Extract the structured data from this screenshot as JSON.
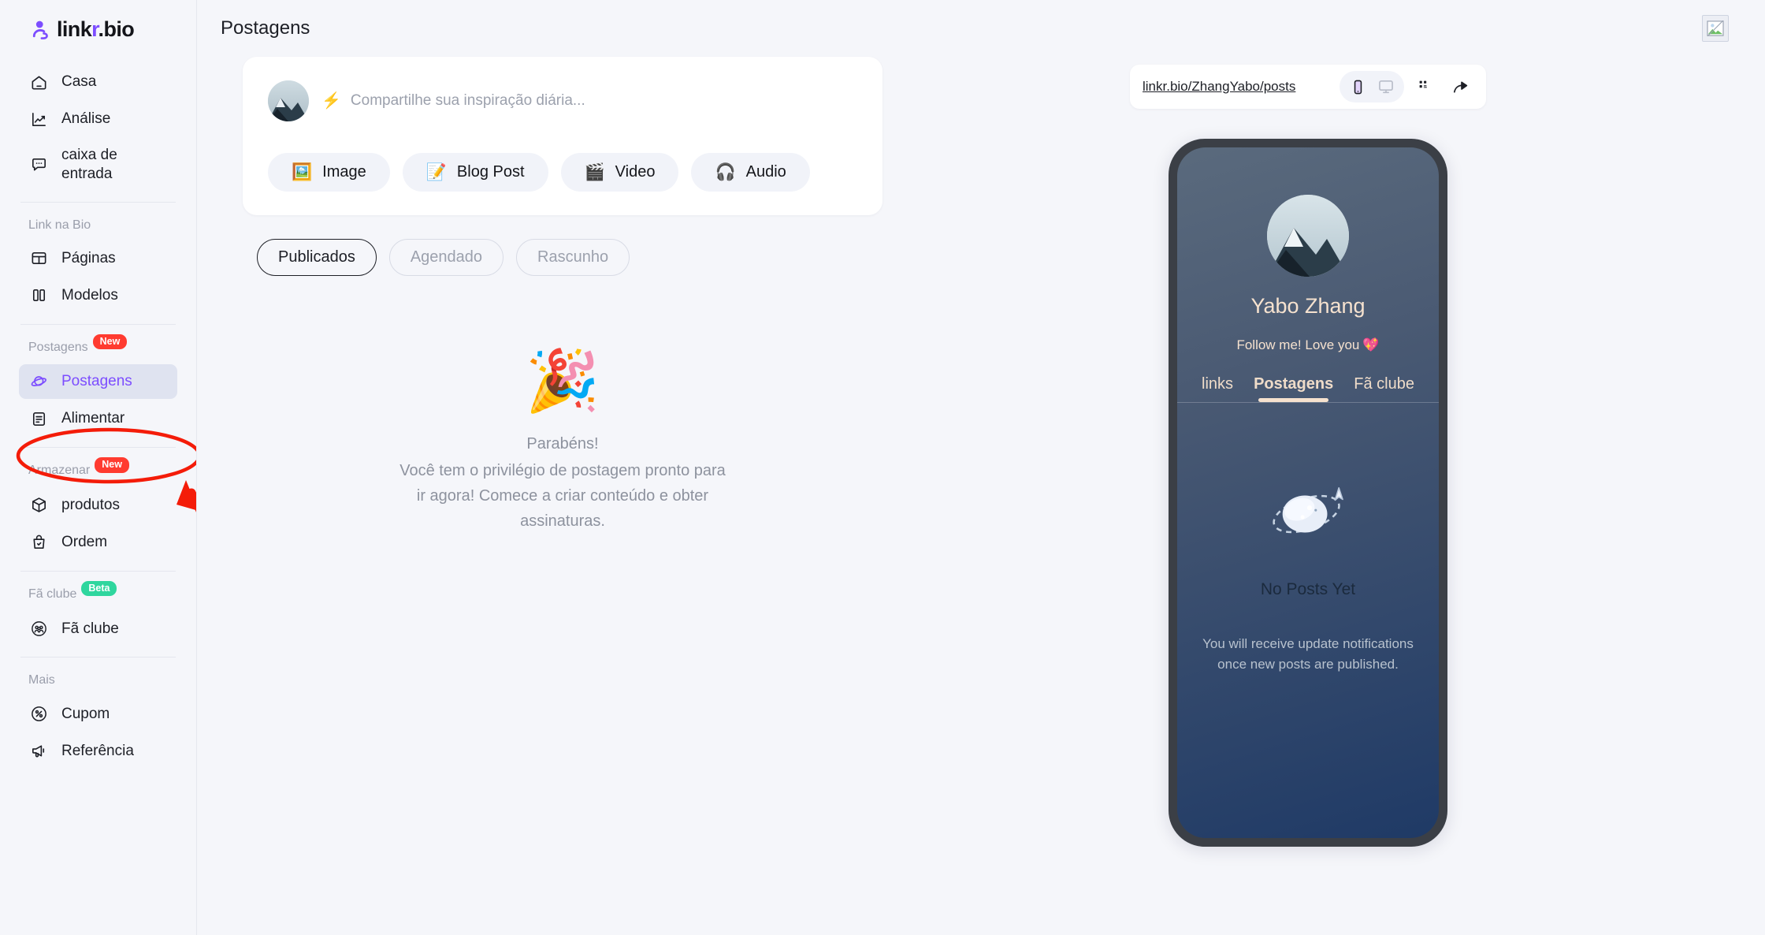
{
  "brand": {
    "name_prefix": "link",
    "name_accent": "r",
    "name_suffix": ".bio",
    "logo_icon": "person-link-logo-icon",
    "accent_color": "#7c4dff"
  },
  "sidebar": {
    "primary": [
      {
        "label": "Casa",
        "icon": "home-icon"
      },
      {
        "label": "Análise",
        "icon": "analytics-chart-icon"
      },
      {
        "label": "caixa de\nentrada",
        "icon": "inbox-chat-icon"
      }
    ],
    "sections": [
      {
        "title": "Link na Bio",
        "badge": null,
        "items": [
          {
            "label": "Páginas",
            "icon": "layout-pages-icon"
          },
          {
            "label": "Modelos",
            "icon": "templates-columns-icon"
          }
        ]
      },
      {
        "title": "Postagens",
        "badge": "New",
        "badge_type": "new",
        "items": [
          {
            "label": "Postagens",
            "icon": "planet-icon",
            "active": true
          },
          {
            "label": "Alimentar",
            "icon": "feed-document-icon"
          }
        ]
      },
      {
        "title": "Armazenar",
        "badge": "New",
        "badge_type": "new",
        "items": [
          {
            "label": "produtos",
            "icon": "box-product-icon"
          },
          {
            "label": "Ordem",
            "icon": "order-bag-icon"
          }
        ]
      },
      {
        "title": "Fã clube",
        "badge": "Beta",
        "badge_type": "beta",
        "items": [
          {
            "label": "Fã clube",
            "icon": "fan-club-people-icon"
          }
        ]
      },
      {
        "title": "Mais",
        "badge": null,
        "items": [
          {
            "label": "Cupom",
            "icon": "percent-coupon-icon"
          },
          {
            "label": "Referência",
            "icon": "megaphone-referral-icon"
          }
        ]
      }
    ]
  },
  "header": {
    "title": "Postagens",
    "right_icon": "broken-image-icon"
  },
  "composer": {
    "avatar_icon": "user-avatar-mountain-photo",
    "bolt_icon": "⚡",
    "placeholder": "Compartilhe sua inspiração diária...",
    "media_buttons": [
      {
        "label": "Image",
        "emoji": "🖼️",
        "icon": "image-icon"
      },
      {
        "label": "Blog Post",
        "emoji": "📝",
        "icon": "blog-post-icon"
      },
      {
        "label": "Video",
        "emoji": "🎬",
        "icon": "video-clapper-icon"
      },
      {
        "label": "Audio",
        "emoji": "🎧",
        "icon": "audio-headphones-icon"
      }
    ]
  },
  "filters": {
    "tabs": [
      {
        "label": "Publicados",
        "selected": true
      },
      {
        "label": "Agendado",
        "selected": false
      },
      {
        "label": "Rascunho",
        "selected": false
      }
    ]
  },
  "empty_state": {
    "emoji": "🎉",
    "icon": "party-popper-icon",
    "title": "Parabéns!",
    "body": "Você tem o privilégio de postagem pronto para ir agora! Comece a criar conteúdo e obter assinaturas."
  },
  "preview": {
    "url": "linkr.bio/ZhangYabo/posts",
    "device_toggle": [
      {
        "icon": "mobile-phone-icon",
        "active": true
      },
      {
        "icon": "desktop-monitor-icon",
        "active": false
      }
    ],
    "qr_icon": "qr-code-icon",
    "share_icon": "share-arrow-icon",
    "profile": {
      "avatar_icon": "profile-avatar-mountain-photo",
      "name": "Yabo Zhang",
      "bio": "Follow me! Love you",
      "bio_emoji": "💖"
    },
    "tabs": [
      {
        "label": "links",
        "active": false
      },
      {
        "label": "Postagens",
        "active": true
      },
      {
        "label": "Fã clube",
        "active": false
      }
    ],
    "empty": {
      "icon": "planet-orbit-icon",
      "title": "No Posts Yet",
      "subtitle": "You will receive update notifications once new posts are published."
    }
  },
  "annotation": {
    "ellipse_color": "#f41c09",
    "arrow_color": "#f41c09",
    "target": "Postagens"
  }
}
